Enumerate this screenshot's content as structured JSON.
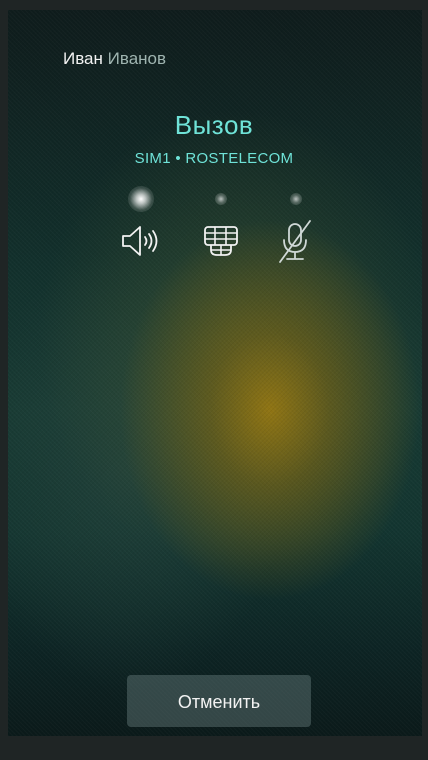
{
  "call": {
    "contact_first": "Иван",
    "contact_last": "Иванов",
    "status": "Вызов",
    "sim_info": "SIM1 • ROSTELECOM"
  },
  "controls": [
    {
      "icon": "speaker-icon",
      "active": true
    },
    {
      "icon": "dialpad-icon",
      "active": false
    },
    {
      "icon": "mic-muted-icon",
      "active": false
    }
  ],
  "actions": {
    "cancel_label": "Отменить"
  },
  "colors": {
    "accent": "#6fe3d8",
    "text": "#f2f2f2",
    "muted": "#9fb4b0"
  }
}
